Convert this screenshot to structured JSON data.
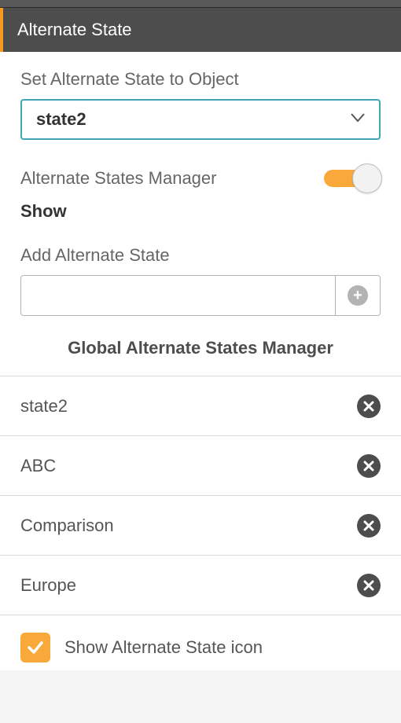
{
  "header": {
    "title": "Alternate State"
  },
  "setState": {
    "label": "Set Alternate State to Object",
    "value": "state2"
  },
  "manager": {
    "label": "Alternate States Manager",
    "toggle_on": true,
    "show_label": "Show"
  },
  "addState": {
    "label": "Add Alternate State",
    "value": "",
    "placeholder": ""
  },
  "globalHeader": "Global Alternate States Manager",
  "states": [
    {
      "name": "state2"
    },
    {
      "name": "ABC"
    },
    {
      "name": "Comparison"
    },
    {
      "name": "Europe"
    }
  ],
  "showIcon": {
    "checked": true,
    "label": "Show Alternate State icon"
  },
  "colors": {
    "accent": "#f8a93a",
    "header_bg": "#4d4d4d",
    "dropdown_border": "#3fa6b2"
  }
}
